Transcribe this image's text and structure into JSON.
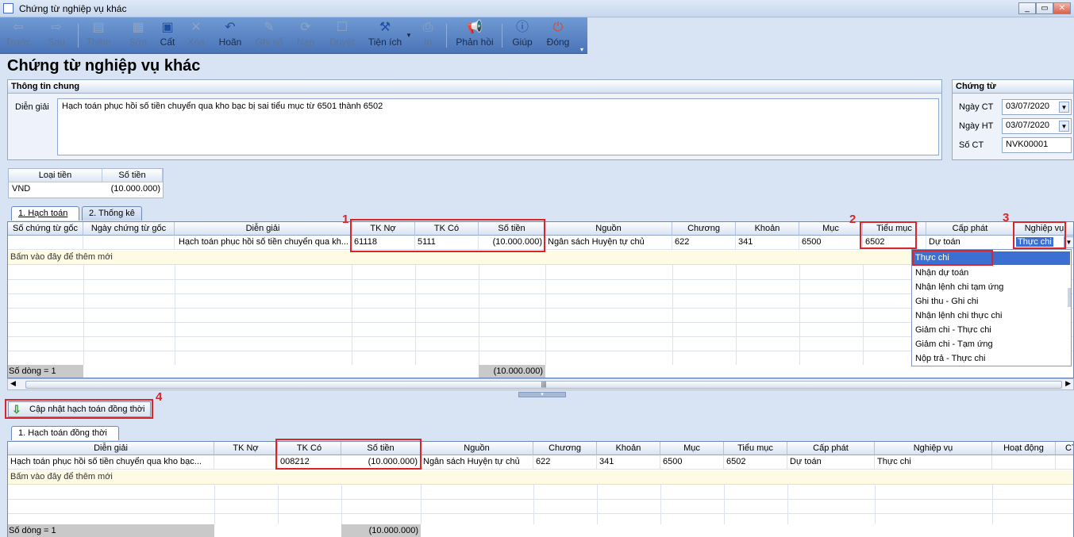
{
  "window": {
    "title": "Chứng từ nghiệp vụ khác"
  },
  "toolbar": {
    "items": [
      {
        "label": "Trước",
        "icon": "arrow-left-icon"
      },
      {
        "label": "Sau",
        "icon": "arrow-right-icon"
      },
      {
        "label": "Thêm",
        "icon": "add-doc-icon"
      },
      {
        "label": "Sửa",
        "icon": "edit-doc-icon"
      },
      {
        "label": "Cất",
        "icon": "save-icon"
      },
      {
        "label": "Xóa",
        "icon": "delete-icon"
      },
      {
        "label": "Hoãn",
        "icon": "undo-icon"
      },
      {
        "label": "Ghi sổ",
        "icon": "pen-icon"
      },
      {
        "label": "Nạp",
        "icon": "reload-icon"
      },
      {
        "label": "Duyệt",
        "icon": "approve-icon"
      },
      {
        "label": "Tiện ích",
        "icon": "tools-icon"
      },
      {
        "label": "In",
        "icon": "print-icon"
      },
      {
        "label": "Phản hồi",
        "icon": "megaphone-icon"
      },
      {
        "label": "Giúp",
        "icon": "help-icon"
      },
      {
        "label": "Đóng",
        "icon": "power-icon"
      }
    ]
  },
  "page_title": "Chứng từ nghiệp vụ khác",
  "general": {
    "header": "Thông tin chung",
    "desc_label": "Diễn giải",
    "desc_value": "Hạch toán phục hồi số tiền chuyển qua kho bạc bị sai tiểu mục từ 6501 thành 6502"
  },
  "voucher": {
    "header": "Chứng từ",
    "date_ct_label": "Ngày CT",
    "date_ct": "03/07/2020",
    "date_ht_label": "Ngày HT",
    "date_ht": "03/07/2020",
    "no_label": "Số CT",
    "no": "NVK00001"
  },
  "currency": {
    "headers": [
      "Loại tiền",
      "Số tiền"
    ],
    "row": [
      "VND",
      "(10.000.000)"
    ]
  },
  "tabs1": [
    "1. Hạch toán",
    "2. Thống kê"
  ],
  "grid1": {
    "headers": [
      "Số chứng từ gốc",
      "Ngày chứng từ gốc",
      "Diễn giải",
      "TK Nợ",
      "TK Có",
      "Số tiền",
      "Nguồn",
      "Chương",
      "Khoản",
      "Mục",
      "Tiểu mục",
      "Cấp phát",
      "Nghiệp vụ"
    ],
    "row": [
      "",
      "",
      "Hạch toán phục hồi số tiền chuyển qua kh...",
      "61118",
      "5111",
      "(10.000.000)",
      "Ngân sách Huyện tự chủ",
      "622",
      "341",
      "6500",
      "6502",
      "Dự toán",
      "Thực chi"
    ],
    "new_row": "Bấm vào đây để thêm mới",
    "footer_count": "Số dòng = 1",
    "footer_total": "(10.000.000)"
  },
  "dropdown": {
    "options": [
      "Thực chi",
      "Nhận dự toán",
      "Nhận lệnh chi tạm ứng",
      "Ghi thu - Ghi chi",
      "Nhận lệnh chi thực chi",
      "Giảm chi - Thực chi",
      "Giảm chi - Tạm ứng",
      "Nộp trả - Thực chi"
    ]
  },
  "annotations": [
    "1",
    "2",
    "3",
    "4"
  ],
  "update_button": "Cập nhật hạch toán đồng thời",
  "tabs2": [
    "1. Hạch toán đồng thời"
  ],
  "grid2": {
    "headers": [
      "Diễn giải",
      "TK Nợ",
      "TK Có",
      "Số tiền",
      "Nguồn",
      "Chương",
      "Khoản",
      "Mục",
      "Tiểu mục",
      "Cấp phát",
      "Nghiệp vụ",
      "Hoạt động",
      "CT"
    ],
    "row": [
      "Hạch toán phục hồi số tiền chuyển qua kho bạc...",
      "",
      "008212",
      "(10.000.000)",
      "Ngân sách Huyện tự chủ",
      "622",
      "341",
      "6500",
      "6502",
      "Dự toán",
      "Thực chi",
      "",
      ""
    ],
    "new_row": "Bấm vào đây để thêm mới",
    "footer_count": "Số dòng = 1",
    "footer_total": "(10.000.000)"
  },
  "colors": {
    "toolbar": "#5a84c4",
    "highlight": "#d9242a",
    "selection": "#3b6fd1"
  }
}
